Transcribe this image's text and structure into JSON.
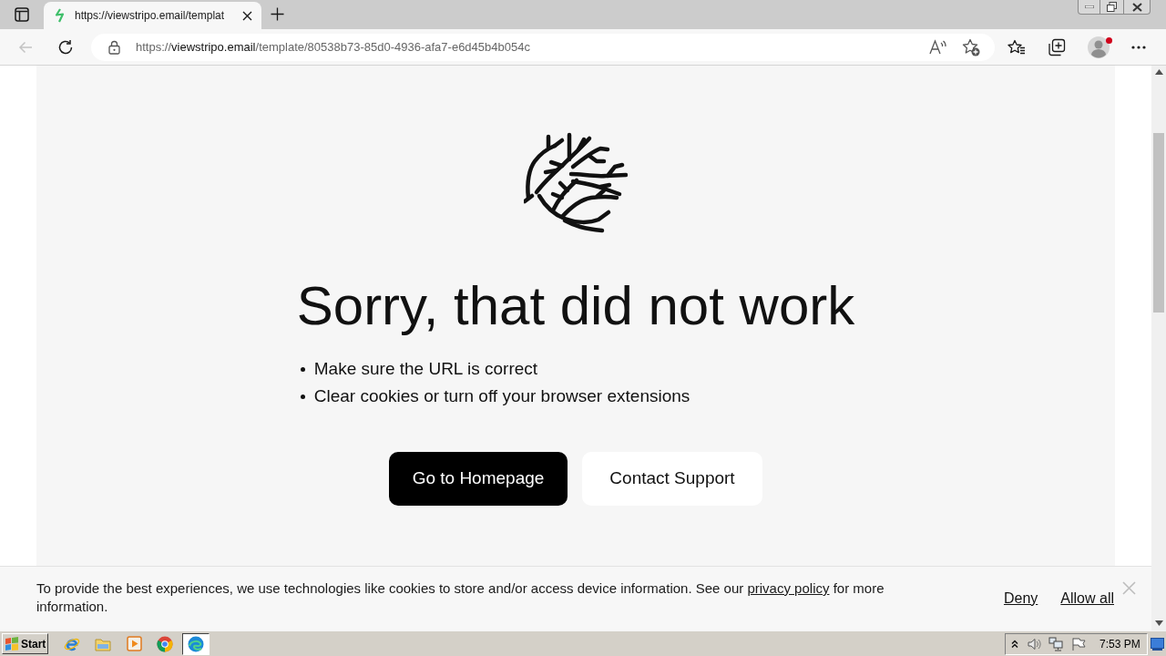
{
  "browser": {
    "tabs": [
      {
        "title": "https://viewstripo.email/templat",
        "selected": true
      }
    ],
    "back_button": {
      "disabled": true
    },
    "address": {
      "scheme": "https://",
      "host": "viewstripo.email",
      "path": "/template/80538b73-85d0-4936-afa7-e6d45b4b054c"
    },
    "profile": {
      "notification": true
    }
  },
  "page": {
    "heading": "Sorry, that did not work",
    "tips": [
      "Make sure the URL is correct",
      "Clear cookies or turn off your browser extensions"
    ],
    "buttons": [
      {
        "label": "Go to Homepage",
        "kind": "primary"
      },
      {
        "label": "Contact Support",
        "kind": "secondary"
      }
    ]
  },
  "cookie_banner": {
    "text": "To provide the best experiences, we use technologies like cookies to store and/or access device information. See our",
    "link": "privacy policy",
    "text_after": "for more information.",
    "actions": [
      "Deny",
      "Allow all"
    ]
  },
  "taskbar": {
    "start": "Start",
    "apps": [
      {
        "kind": "ie",
        "selected": false
      },
      {
        "kind": "folder",
        "selected": false
      },
      {
        "kind": "media",
        "selected": false
      },
      {
        "kind": "chrome",
        "selected": false
      },
      {
        "kind": "edge",
        "selected": true
      }
    ],
    "clock": "7:53 PM"
  }
}
